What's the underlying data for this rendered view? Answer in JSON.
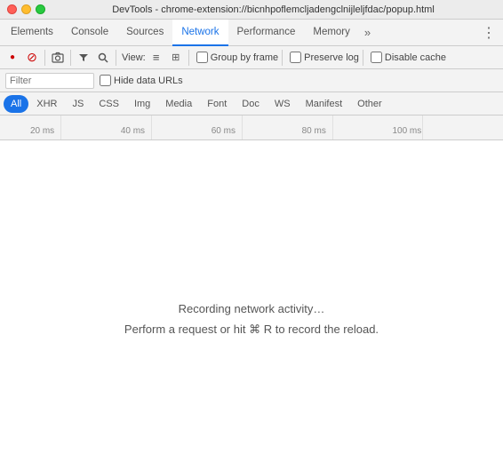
{
  "titleBar": {
    "title": "DevTools - chrome-extension://bicnhpoflemcljadengclnijleljfdac/popup.html"
  },
  "mainNav": {
    "tabs": [
      {
        "id": "elements",
        "label": "Elements"
      },
      {
        "id": "console",
        "label": "Console"
      },
      {
        "id": "sources",
        "label": "Sources"
      },
      {
        "id": "network",
        "label": "Network"
      },
      {
        "id": "performance",
        "label": "Performance"
      },
      {
        "id": "memory",
        "label": "Memory"
      }
    ],
    "activeTab": "network",
    "moreIcon": "≫",
    "menuIcon": "⋮"
  },
  "toolbar": {
    "recordLabel": "●",
    "stopLabel": "⊘",
    "cameraLabel": "📷",
    "filterLabel": "▾",
    "searchLabel": "🔍",
    "viewLabel": "View:",
    "listViewIcon": "≡",
    "tableViewIcon": "⠿",
    "groupByFrame": {
      "label": "Group by frame",
      "checked": false
    },
    "preserveLog": {
      "label": "Preserve log",
      "checked": false
    },
    "disableCache": {
      "label": "Disable cache",
      "checked": false
    }
  },
  "filterRow": {
    "placeholder": "Filter",
    "hideDataURLs": {
      "label": "Hide data URLs",
      "checked": false
    }
  },
  "typeTabs": [
    {
      "id": "all",
      "label": "All",
      "active": true
    },
    {
      "id": "xhr",
      "label": "XHR"
    },
    {
      "id": "js",
      "label": "JS"
    },
    {
      "id": "css",
      "label": "CSS"
    },
    {
      "id": "img",
      "label": "Img"
    },
    {
      "id": "media",
      "label": "Media"
    },
    {
      "id": "font",
      "label": "Font"
    },
    {
      "id": "doc",
      "label": "Doc"
    },
    {
      "id": "ws",
      "label": "WS"
    },
    {
      "id": "manifest",
      "label": "Manifest"
    },
    {
      "id": "other",
      "label": "Other"
    }
  ],
  "timeline": {
    "markers": [
      {
        "label": "20 ms",
        "position": 12
      },
      {
        "label": "40 ms",
        "position": 22
      },
      {
        "label": "60 ms",
        "position": 47
      },
      {
        "label": "80 ms",
        "position": 67
      },
      {
        "label": "100 ms",
        "position": 85
      }
    ]
  },
  "mainContent": {
    "recordingMessage": "Recording network activity…",
    "hintMessage": "Perform a request or hit ⌘ R to record the reload."
  },
  "colors": {
    "accent": "#1a73e8",
    "record": "#cc0000"
  }
}
